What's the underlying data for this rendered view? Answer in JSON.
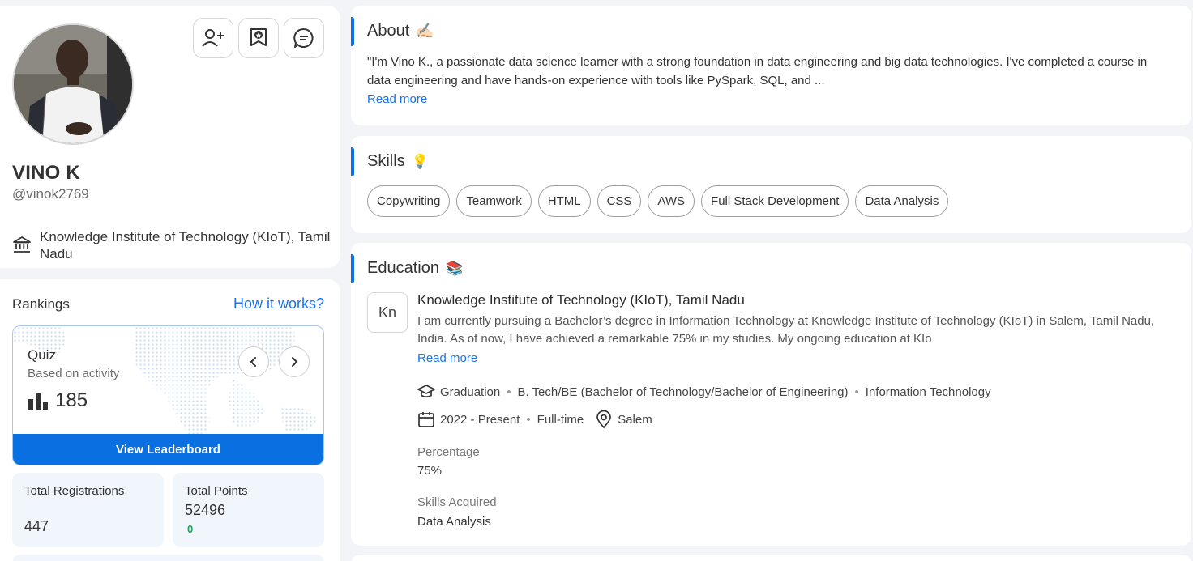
{
  "profile": {
    "name": "VINO K",
    "handle": "@vinok2769",
    "institution": "Knowledge Institute of Technology (KIoT), Tamil Nadu"
  },
  "rankings": {
    "title": "Rankings",
    "help_link": "How it works?",
    "quiz": {
      "title": "Quiz",
      "subtitle": "Based on activity",
      "rank": "185"
    },
    "leaderboard_button": "View Leaderboard",
    "stats": [
      {
        "label": "Total Registrations",
        "value": "447"
      },
      {
        "label": "Total Points",
        "value": "52496",
        "delta": "0"
      }
    ]
  },
  "about": {
    "title": "About",
    "title_emoji": "✍🏻",
    "text": "\"I'm Vino K., a passionate data science learner with a strong foundation in data engineering and big data technologies. I've completed a course in data engineering and have hands-on experience with tools like PySpark, SQL, and ...",
    "read_more": "Read more"
  },
  "skills": {
    "title": "Skills",
    "title_emoji": "💡",
    "items": [
      "Copywriting",
      "Teamwork",
      "HTML",
      "CSS",
      "AWS",
      "Full Stack Development",
      "Data Analysis"
    ]
  },
  "education": {
    "title": "Education",
    "title_emoji": "📚",
    "logo_initials": "Kn",
    "institution": "Knowledge Institute of Technology (KIoT), Tamil Nadu",
    "description": "I am currently pursuing a Bachelor’s degree in Information Technology at Knowledge Institute of Technology (KIoT) in Salem, Tamil Nadu, India. As of now, I have achieved a remarkable 75% in my studies. My ongoing education at KIo",
    "read_more": "Read more",
    "level": "Graduation",
    "degree": "B. Tech/BE (Bachelor of Technology/Bachelor of Engineering)",
    "branch": "Information Technology",
    "duration": "2022 - Present",
    "type": "Full-time",
    "location": "Salem",
    "percentage_label": "Percentage",
    "percentage": "75%",
    "skills_label": "Skills Acquired",
    "skills_acquired": "Data Analysis"
  },
  "colors": {
    "accent": "#0a6fe0",
    "link": "#1a73e8",
    "positive": "#1aa35a"
  }
}
